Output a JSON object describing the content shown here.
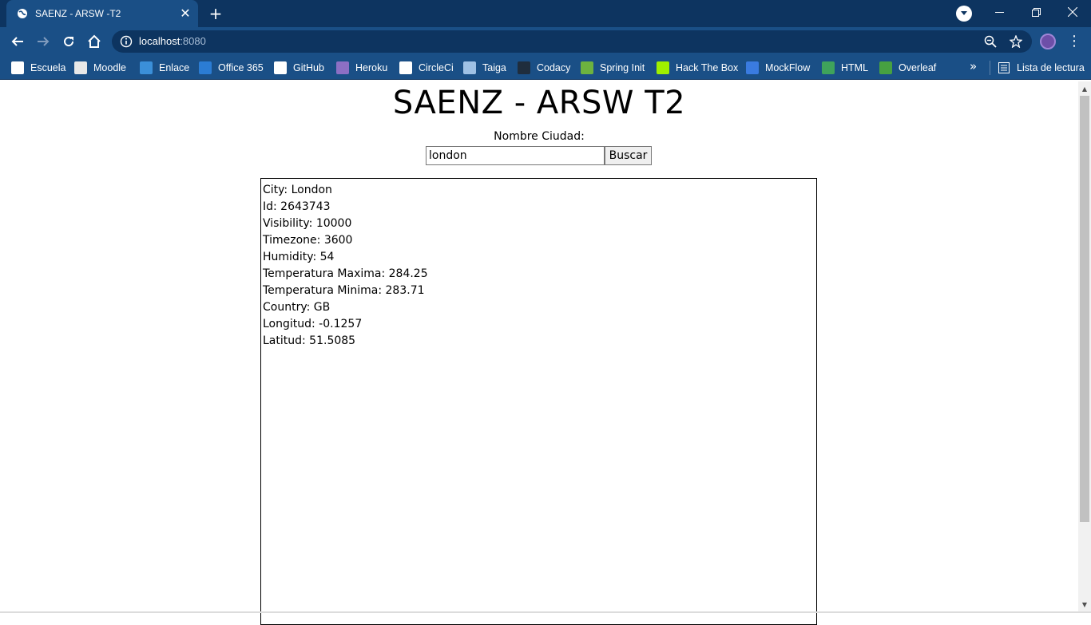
{
  "browser": {
    "tab_title": "SAENZ - ARSW -T2",
    "url_host": "localhost",
    "url_port": ":8080",
    "accent": "#1a4f86",
    "frame_color": "#0d3460"
  },
  "bookmarks": [
    {
      "label": "Escuela",
      "icon": "book-icon",
      "color": "#ffffff"
    },
    {
      "label": "Moodle",
      "icon": "moodle-icon",
      "color": "#e8e8e8"
    },
    {
      "label": "Enlace",
      "icon": "enlace-icon",
      "color": "#3b8fd8"
    },
    {
      "label": "Office 365",
      "icon": "office-icon",
      "color": "#2b7cd3"
    },
    {
      "label": "GitHub",
      "icon": "github-icon",
      "color": "#ffffff"
    },
    {
      "label": "Heroku",
      "icon": "heroku-icon",
      "color": "#8c6fc4"
    },
    {
      "label": "CircleCi",
      "icon": "circleci-icon",
      "color": "#ffffff"
    },
    {
      "label": "Taiga",
      "icon": "taiga-icon",
      "color": "#9fc1e5"
    },
    {
      "label": "Codacy",
      "icon": "codacy-icon",
      "color": "#1f2d3d"
    },
    {
      "label": "Spring Init",
      "icon": "spring-icon",
      "color": "#6db33f"
    },
    {
      "label": "Hack The Box",
      "icon": "hackthebox-icon",
      "color": "#9fef00"
    },
    {
      "label": "MockFlow",
      "icon": "mockflow-icon",
      "color": "#3a7be0"
    },
    {
      "label": "HTML",
      "icon": "html-icon",
      "color": "#3fa35b"
    },
    {
      "label": "Overleaf",
      "icon": "overleaf-icon",
      "color": "#47a141"
    }
  ],
  "reading_list": "Lista de lectura",
  "page": {
    "title": "SAENZ - ARSW T2",
    "city_label": "Nombre Ciudad:",
    "city_value": "london",
    "search_button": "Buscar",
    "results": [
      "City: London",
      "Id: 2643743",
      "Visibility: 10000",
      "Timezone: 3600",
      "Humidity: 54",
      "Temperatura Maxima: 284.25",
      "Temperatura Minima: 283.71",
      "Country: GB",
      "Longitud: -0.1257",
      "Latitud: 51.5085"
    ]
  }
}
